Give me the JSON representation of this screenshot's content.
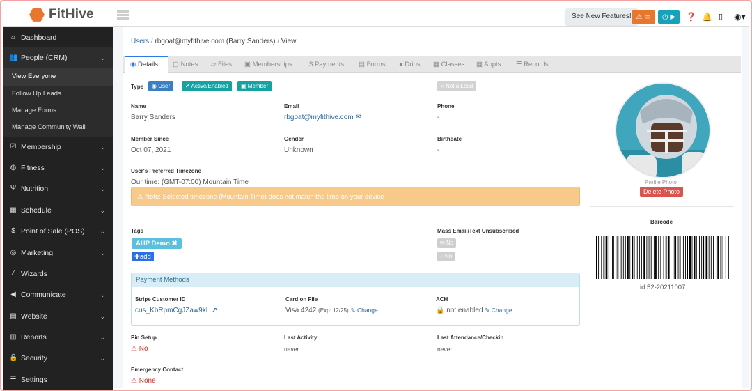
{
  "app": {
    "name": "FitHive"
  },
  "topbar": {
    "features_label": "See New Features!",
    "colors": {
      "orange": "#e8762c",
      "teal": "#17a2b8"
    }
  },
  "sidebar": {
    "items": [
      {
        "label": "Dashboard",
        "icon": "home-icon",
        "chevron": false
      },
      {
        "label": "People (CRM)",
        "icon": "users-icon",
        "chevron": true
      },
      {
        "label": "Membership",
        "icon": "check-square-icon",
        "chevron": true
      },
      {
        "label": "Fitness",
        "icon": "fitness-icon",
        "chevron": true
      },
      {
        "label": "Nutrition",
        "icon": "utensils-icon",
        "chevron": true
      },
      {
        "label": "Schedule",
        "icon": "calendar-icon",
        "chevron": true
      },
      {
        "label": "Point of Sale (POS)",
        "icon": "dollar-icon",
        "chevron": true
      },
      {
        "label": "Marketing",
        "icon": "bullseye-icon",
        "chevron": true
      },
      {
        "label": "Wizards",
        "icon": "wand-icon",
        "chevron": false
      },
      {
        "label": "Communicate",
        "icon": "bullhorn-icon",
        "chevron": true
      },
      {
        "label": "Website",
        "icon": "file-icon",
        "chevron": true
      },
      {
        "label": "Reports",
        "icon": "chart-icon",
        "chevron": true
      },
      {
        "label": "Security",
        "icon": "lock-icon",
        "chevron": true
      },
      {
        "label": "Settings",
        "icon": "sliders-icon",
        "chevron": false
      }
    ],
    "subitems": [
      "View Everyone",
      "Follow Up Leads",
      "Manage Forms",
      "Manage Community Wall"
    ]
  },
  "breadcrumb": {
    "users": "Users",
    "user": "rbgoat@myfithive.com (Barry Sanders)",
    "view": "View",
    "sep": "/"
  },
  "tabs": [
    "Details",
    "Notes",
    "Files",
    "Memberships",
    "Payments",
    "Forms",
    "Drips",
    "Classes",
    "Appts",
    "Records"
  ],
  "details": {
    "type_label": "Type",
    "badges": {
      "user": "User",
      "active": "Active/Enabled",
      "member": "Member",
      "not_lead": "Not a Lead"
    },
    "name_label": "Name",
    "name": "Barry Sanders",
    "email_label": "Email",
    "email": "rbgoat@myfithive.com",
    "phone_label": "Phone",
    "phone": "-",
    "since_label": "Member Since",
    "since": "Oct 07, 2021",
    "gender_label": "Gender",
    "gender": "Unknown",
    "birth_label": "Birthdate",
    "birth": "-",
    "tz_label": "User's Preferred Timezone",
    "tz": "Our time: (GMT-07:00) Mountain Time",
    "alert": "Note: Selected timezone (Mountain Time) does not match the time on your device",
    "tags_label": "Tags",
    "tag": "AHP Demo",
    "add": "add",
    "unsub_label": "Mass Email/Text Unsubscribed",
    "no": "No",
    "payment_title": "Payment Methods",
    "stripe_label": "Stripe Customer ID",
    "stripe_id": "cus_KbRpmCgJZaw9kL",
    "card_label": "Card on File",
    "card": "Visa 4242",
    "card_exp": "(Exp: 12/25)",
    "change": "Change",
    "ach_label": "ACH",
    "ach": "not enabled",
    "pin_label": "Pin Setup",
    "pin": "No",
    "activity_label": "Last Activity",
    "activity": "never",
    "attend_label": "Last Attendance/Checkin",
    "attend": "never",
    "emergency_label": "Emergency Contact",
    "emergency": "None"
  },
  "profile": {
    "photo_label": "Profile Photo",
    "delete": "Delete Photo",
    "barcode_label": "Barcode",
    "barcode_id": "id:52-20211007"
  }
}
